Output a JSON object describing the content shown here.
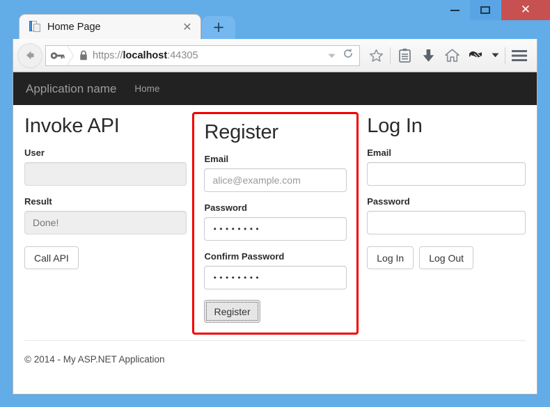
{
  "window": {
    "controls": {
      "minimize_icon": "minimize-icon",
      "maximize_icon": "maximize-restore-icon",
      "close_label": "✕"
    },
    "frame_color": "#62ace8",
    "close_color": "#c75050"
  },
  "browser": {
    "tab": {
      "title": "Home Page",
      "favicon": "page-document-icon",
      "close_label": "✕"
    },
    "new_tab_label": "+",
    "back_icon": "back-arrow-icon",
    "address": {
      "identity_icon": "key-icon",
      "lock_icon": "padlock-icon",
      "scheme": "https://",
      "host": "localhost",
      "port": ":44305",
      "full_url": "https://localhost:44305",
      "dropdown_icon": "chevron-down-icon",
      "reload_icon": "reload-icon"
    },
    "toolbar_icons": [
      "bookmark-star-icon",
      "reading-list-icon",
      "downloads-icon",
      "home-icon",
      "pocket-icon",
      "overflow-chevron-icon",
      "hamburger-menu-icon"
    ]
  },
  "site": {
    "brand": "Application name",
    "nav": [
      {
        "label": "Home"
      }
    ],
    "footer": "© 2014 - My ASP.NET Application"
  },
  "invoke_api": {
    "title": "Invoke API",
    "user_label": "User",
    "user_value": "",
    "user_placeholder": "",
    "result_label": "Result",
    "result_value": "Done!",
    "call_button": "Call API"
  },
  "register": {
    "title": "Register",
    "highlight_color": "#f20000",
    "email_label": "Email",
    "email_value": "alice@example.com",
    "password_label": "Password",
    "password_value": "••••••••",
    "confirm_label": "Confirm Password",
    "confirm_value": "••••••••",
    "register_button": "Register"
  },
  "login": {
    "title": "Log In",
    "email_label": "Email",
    "email_value": "",
    "password_label": "Password",
    "password_value": "",
    "login_button": "Log In",
    "logout_button": "Log Out"
  }
}
